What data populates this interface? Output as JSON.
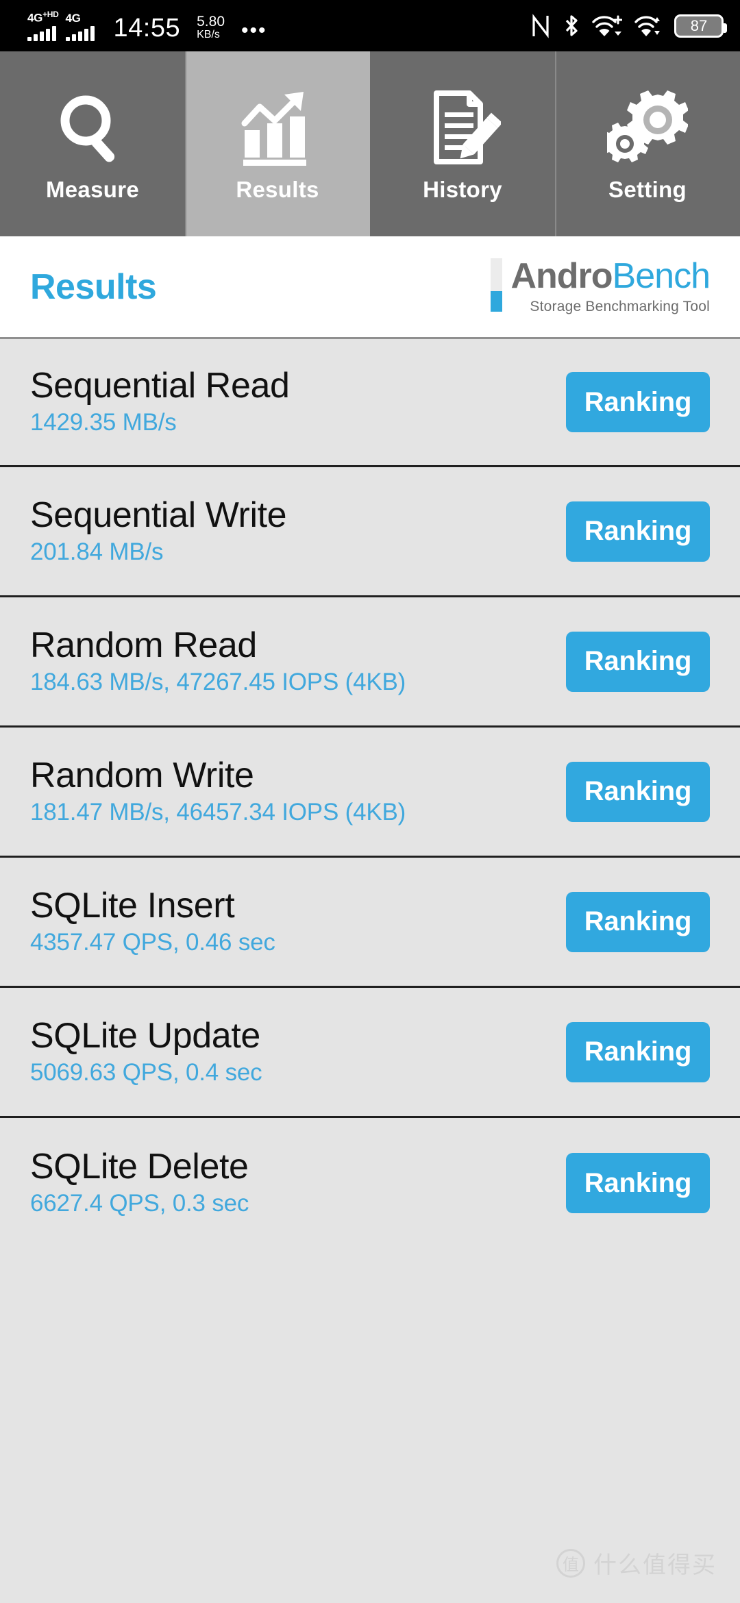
{
  "statusbar": {
    "network_1": "4G",
    "network_1_sup": "+HD",
    "network_2": "4G",
    "time": "14:55",
    "speed_value": "5.80",
    "speed_unit": "KB/s",
    "overflow": "•••",
    "icons": [
      "nfc-icon",
      "bluetooth-icon",
      "wifi-plus-icon",
      "wifi-arrow-icon",
      "battery-icon"
    ],
    "battery_level": "87"
  },
  "tabs": [
    {
      "label": "Measure",
      "icon": "magnifier-icon",
      "active": false
    },
    {
      "label": "Results",
      "icon": "bar-chart-arrow-icon",
      "active": true
    },
    {
      "label": "History",
      "icon": "document-pencil-icon",
      "active": false
    },
    {
      "label": "Setting",
      "icon": "gears-icon",
      "active": false
    }
  ],
  "header": {
    "title": "Results",
    "brand_gray": "Andro",
    "brand_blue": "Bench",
    "tagline": "Storage Benchmarking Tool"
  },
  "results": [
    {
      "title": "Sequential Read",
      "value": "1429.35 MB/s",
      "button": "Ranking"
    },
    {
      "title": "Sequential Write",
      "value": "201.84 MB/s",
      "button": "Ranking"
    },
    {
      "title": "Random Read",
      "value": "184.63 MB/s, 47267.45 IOPS (4KB)",
      "button": "Ranking"
    },
    {
      "title": "Random Write",
      "value": "181.47 MB/s, 46457.34 IOPS (4KB)",
      "button": "Ranking"
    },
    {
      "title": "SQLite Insert",
      "value": "4357.47 QPS, 0.46 sec",
      "button": "Ranking"
    },
    {
      "title": "SQLite Update",
      "value": "5069.63 QPS, 0.4 sec",
      "button": "Ranking"
    },
    {
      "title": "SQLite Delete",
      "value": "6627.4 QPS, 0.3 sec",
      "button": "Ranking"
    }
  ],
  "watermark": {
    "badge": "值",
    "text": "什么值得买"
  },
  "colors": {
    "accent_blue": "#31a8df",
    "value_blue": "#41a8dd",
    "title_blue": "#2fa8dd",
    "tab_inactive": "#6b6b6b",
    "tab_active": "#b4b4b4",
    "list_bg": "#e4e4e4",
    "row_divider": "#1f1f1f",
    "brand_gray": "#6d6d6d"
  }
}
